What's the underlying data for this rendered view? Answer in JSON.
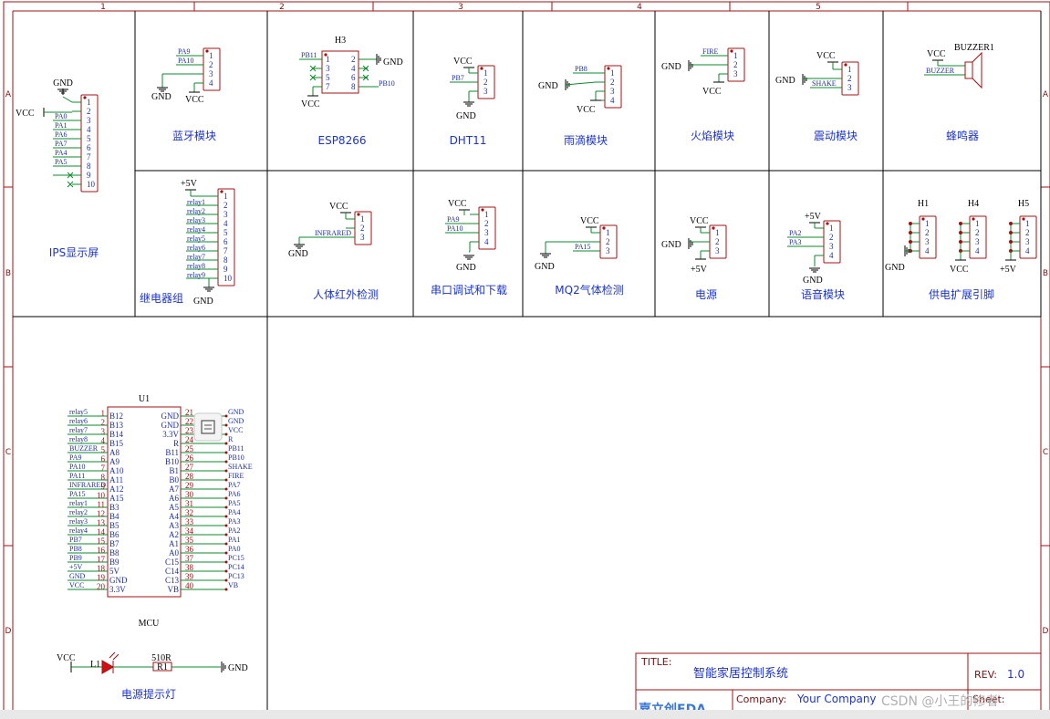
{
  "frame": {
    "col_labels": [
      "1",
      "2",
      "3",
      "4",
      "5"
    ],
    "row_labels": [
      "A",
      "B",
      "C",
      "D"
    ]
  },
  "modules": {
    "bluetooth": {
      "title": "蓝牙模块",
      "nets": [
        "PA9",
        "PA10"
      ],
      "gnd": "GND",
      "vcc": "VCC",
      "pins": [
        "1",
        "2",
        "3",
        "4"
      ]
    },
    "esp8266": {
      "title": "ESP8266",
      "ref": "H3",
      "nets": [
        "PB11",
        "PB10"
      ],
      "gnd": "GND",
      "vcc": "VCC",
      "pins_left": [
        "1",
        "3",
        "5",
        "7"
      ],
      "pins_right": [
        "2",
        "4",
        "6",
        "8"
      ]
    },
    "dht11": {
      "title": "DHT11",
      "nets": [
        "PB7"
      ],
      "vcc": "VCC",
      "gnd": "GND",
      "pins": [
        "1",
        "2",
        "3"
      ]
    },
    "rain": {
      "title": "雨滴模块",
      "nets": [
        "PB8"
      ],
      "gnd": "GND",
      "vcc": "VCC",
      "pins": [
        "1",
        "2",
        "3",
        "4"
      ]
    },
    "flame": {
      "title": "火焰模块",
      "nets": [
        "FIRE"
      ],
      "gnd": "GND",
      "vcc": "VCC",
      "pins": [
        "1",
        "2",
        "3"
      ]
    },
    "vibration": {
      "title": "震动模块",
      "nets": [
        "SHAKE"
      ],
      "gnd": "GND",
      "vcc": "VCC",
      "pins": [
        "1",
        "2",
        "3"
      ]
    },
    "buzzer": {
      "title": "蜂鸣器",
      "ref": "BUZZER1",
      "nets": [
        "BUZZER"
      ],
      "vcc": "VCC"
    },
    "ips": {
      "title": "IPS显示屏",
      "nets": [
        "PA0",
        "PA1",
        "PA6",
        "PA7",
        "PA4",
        "PA5"
      ],
      "gnd": "GND",
      "vcc": "VCC",
      "pins": [
        "1",
        "2",
        "3",
        "4",
        "5",
        "6",
        "7",
        "8",
        "9",
        "10"
      ]
    },
    "relay": {
      "title": "继电器组",
      "vcc": "+5V",
      "gnd": "GND",
      "nets": [
        "relay1",
        "relay2",
        "relay3",
        "relay4",
        "relay5",
        "relay6",
        "relay7",
        "relay8",
        "relay9"
      ],
      "pins": [
        "1",
        "2",
        "3",
        "4",
        "5",
        "6",
        "7",
        "8",
        "9",
        "10"
      ]
    },
    "pir": {
      "title": "人体红外检测",
      "nets": [
        "INFRARED"
      ],
      "vcc": "VCC",
      "gnd": "GND",
      "pins": [
        "1",
        "2",
        "3"
      ]
    },
    "uart": {
      "title": "串口调试和下载",
      "nets": [
        "PA9",
        "PA10"
      ],
      "vcc": "VCC",
      "gnd": "GND",
      "pins": [
        "1",
        "2",
        "3",
        "4"
      ]
    },
    "mq2": {
      "title": "MQ2气体检测",
      "nets": [
        "PA15"
      ],
      "vcc": "VCC",
      "gnd": "GND",
      "pins": [
        "1",
        "2",
        "3"
      ]
    },
    "power": {
      "title": "电源",
      "vcc": "VCC",
      "gnd": "GND",
      "v5": "+5V",
      "pins": [
        "1",
        "2",
        "3"
      ]
    },
    "voice": {
      "title": "语音模块",
      "nets": [
        "PA2",
        "PA3"
      ],
      "v5": "+5V",
      "gnd": "GND",
      "pins": [
        "1",
        "2",
        "3",
        "4"
      ]
    },
    "supply": {
      "title": "供电扩展引脚",
      "refs": [
        "H1",
        "H4",
        "H5"
      ],
      "nets": [
        "GND",
        "VCC",
        "+5V"
      ],
      "pins": [
        "1",
        "2",
        "3",
        "4"
      ]
    },
    "led": {
      "title": "电源提示灯",
      "ref": "L1",
      "res_ref": "R1",
      "res_val": "510R",
      "vcc": "VCC",
      "gnd": "GND"
    }
  },
  "mcu": {
    "ref": "U1",
    "name": "MCU",
    "left_nets": [
      "relay5",
      "relay6",
      "relay7",
      "relay8",
      "BUZZER",
      "PA9",
      "PA10",
      "PA11",
      "INFRARED",
      "PA15",
      "relay1",
      "relay2",
      "relay3",
      "relay4",
      "PB7",
      "PB8",
      "PB9",
      "+5V",
      "GND",
      "VCC"
    ],
    "left_pins": [
      "B12",
      "B13",
      "B14",
      "B15",
      "A8",
      "A9",
      "A10",
      "A11",
      "A12",
      "A15",
      "B3",
      "B4",
      "B5",
      "B6",
      "B7",
      "B8",
      "B9",
      "5V",
      "GND",
      "3.3V"
    ],
    "left_nums": [
      "1",
      "2",
      "3",
      "4",
      "5",
      "6",
      "7",
      "8",
      "9",
      "10",
      "11",
      "12",
      "13",
      "14",
      "15",
      "16",
      "17",
      "18",
      "19",
      "20"
    ],
    "right_pins": [
      "GND",
      "GND",
      "3.3V",
      "R",
      "B11",
      "B10",
      "B1",
      "B0",
      "A7",
      "A6",
      "A5",
      "A4",
      "A3",
      "A2",
      "A1",
      "A0",
      "C15",
      "C14",
      "C13",
      "VB"
    ],
    "right_nums": [
      "21",
      "22",
      "23",
      "24",
      "25",
      "26",
      "27",
      "28",
      "29",
      "30",
      "31",
      "32",
      "33",
      "34",
      "35",
      "36",
      "37",
      "38",
      "39",
      "40"
    ],
    "right_nets": [
      "GND",
      "GND",
      "VCC",
      "R",
      "PB11",
      "PB10",
      "SHAKE",
      "FIRE",
      "PA7",
      "PA6",
      "PA5",
      "PA4",
      "PA3",
      "PA2",
      "PA1",
      "PA0",
      "PC15",
      "PC14",
      "PC13",
      "VB"
    ]
  },
  "title_block": {
    "title_key": "TITLE:",
    "title": "智能家居控制系统",
    "rev_key": "REV:",
    "rev": "1.0",
    "company_key": "Company:",
    "company": "Your Company",
    "sheet_key": "Sheet:",
    "watermark": "CSDN @小王的修者",
    "logo": "嘉立创EDA"
  },
  "colors": {
    "wire": "#0b8a2a",
    "part": "#a01010",
    "frame": "#a01010",
    "net": "#1e2e9c",
    "title": "#1c34c8"
  }
}
